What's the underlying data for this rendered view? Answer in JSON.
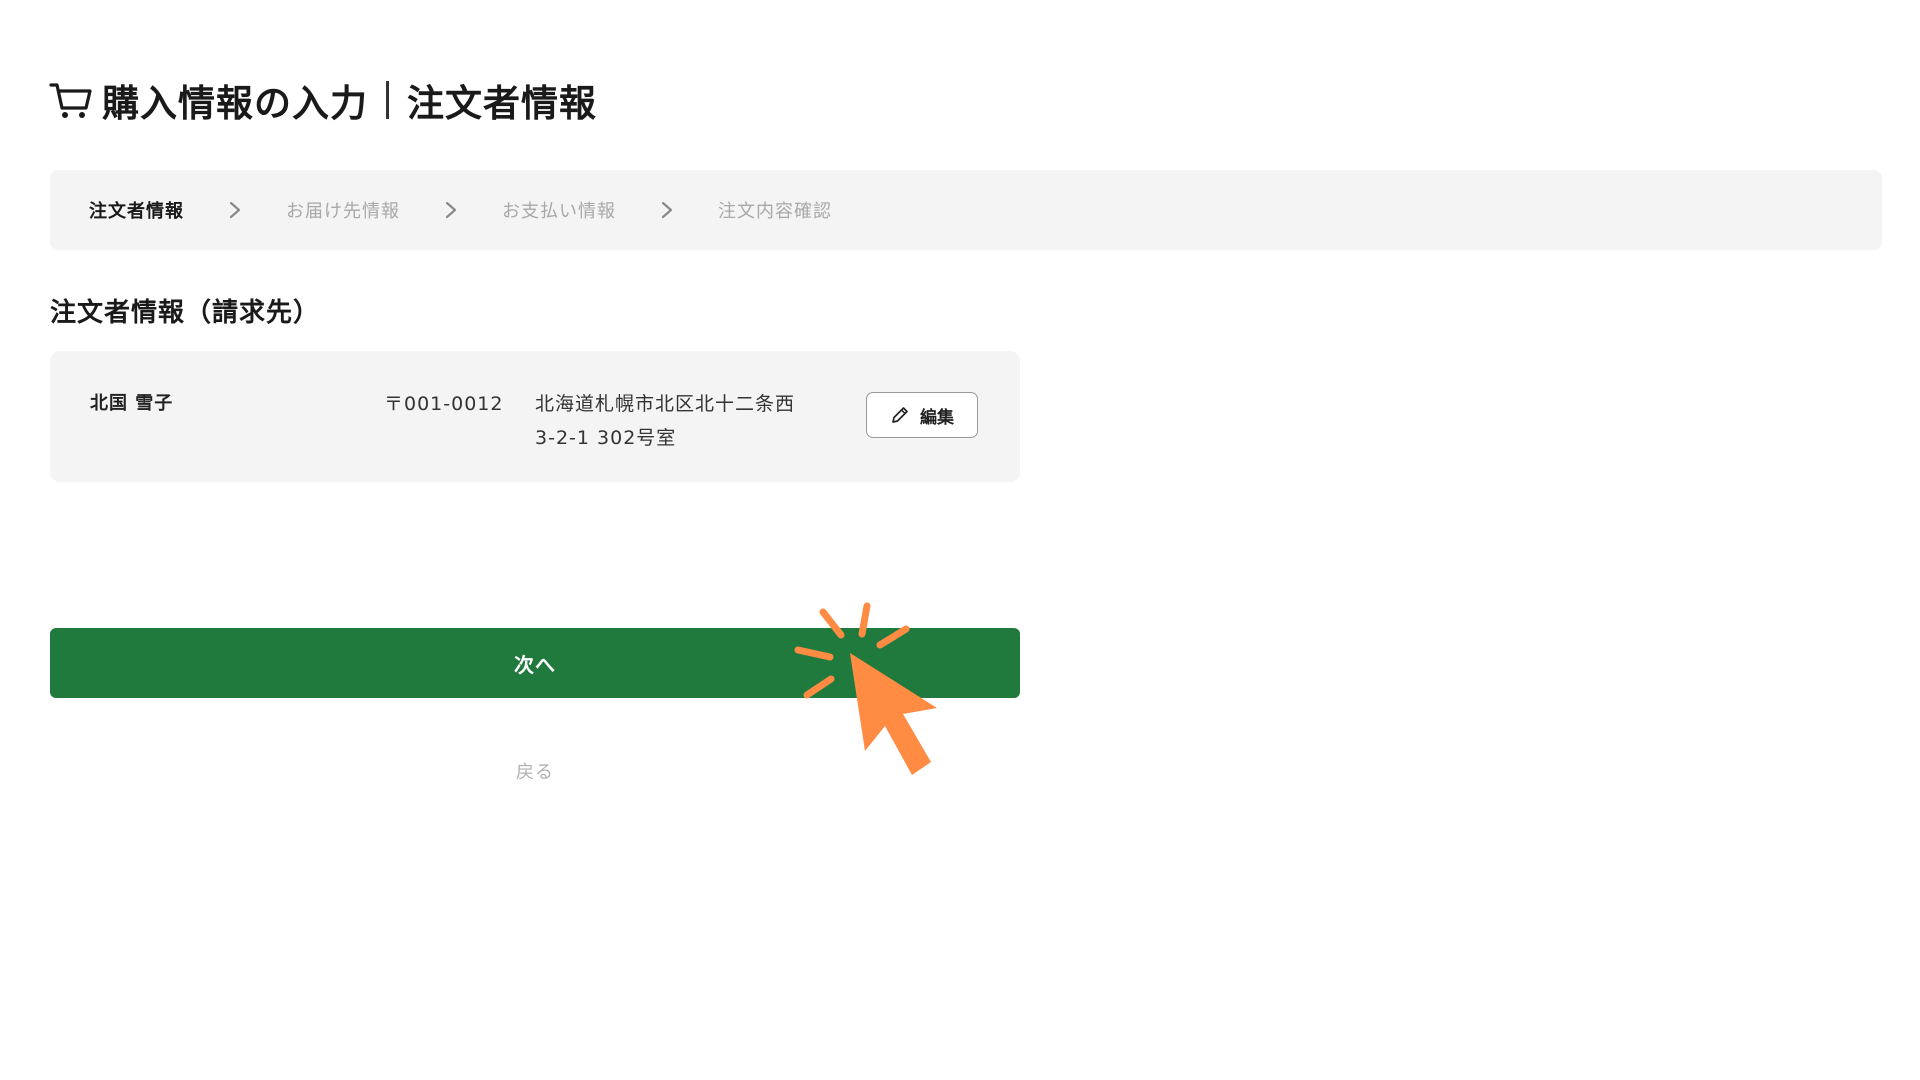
{
  "header": {
    "title_main": "購入情報の入力",
    "title_sub": "注文者情報",
    "cart_icon": "cart-icon"
  },
  "stepper": {
    "steps": [
      {
        "label": "注文者情報",
        "active": true
      },
      {
        "label": "お届け先情報",
        "active": false
      },
      {
        "label": "お支払い情報",
        "active": false
      },
      {
        "label": "注文内容確認",
        "active": false
      }
    ],
    "separator_icon": "chevron-right-icon"
  },
  "section": {
    "heading": "注文者情報（請求先）"
  },
  "customer": {
    "name": "北国 雪子",
    "postal_code": "〒001-0012",
    "address_line1": "北海道札幌市北区北十二条西",
    "address_line2": "3-2-1 302号室",
    "edit_label": "編集",
    "edit_icon": "pencil-icon"
  },
  "actions": {
    "next_label": "次へ",
    "back_label": "戻る"
  },
  "colors": {
    "primary_green": "#217a3d",
    "stepper_bg": "#f4f4f4",
    "card_bg": "#f4f4f4",
    "inactive_text": "#a8a8a8",
    "cursor_orange": "#ff8c42"
  },
  "overlay": {
    "cursor_icon": "click-cursor-icon"
  }
}
